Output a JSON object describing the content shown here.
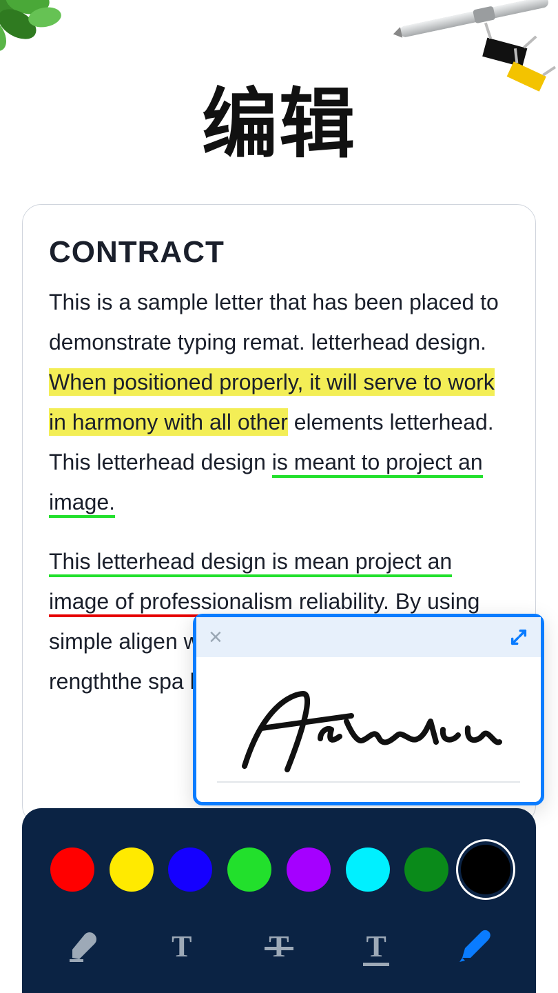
{
  "page_title": "编辑",
  "document": {
    "heading": "CONTRACT",
    "p1_a": "This is a sample letter that has been placed to demonstrate typing remat. letterhead design. ",
    "p1_hl": "When positioned properly, it will serve to work in harmony with all other",
    "p1_b": " elements letterhead. This letterhead design ",
    "p1_ulg": "is meant to project an image.",
    "p2_ulg": "This letterhead design is mean project an",
    "p2_ulr": "image of professionalism reliability. By using",
    "p2_rest": " simple aligen with open spacious feeling rengththe spa haesthetics th"
  },
  "signature": {
    "text": "Franken"
  },
  "colors": [
    {
      "name": "red",
      "hex": "#ff0000"
    },
    {
      "name": "yellow",
      "hex": "#ffea00"
    },
    {
      "name": "blue",
      "hex": "#1500ff"
    },
    {
      "name": "green",
      "hex": "#22e02c"
    },
    {
      "name": "purple",
      "hex": "#a500ff"
    },
    {
      "name": "cyan",
      "hex": "#00f0ff"
    },
    {
      "name": "dark-green",
      "hex": "#0a8a1a"
    },
    {
      "name": "black",
      "hex": "#000000"
    }
  ],
  "selected_color_index": 7,
  "tools": [
    {
      "name": "highlighter",
      "active": false
    },
    {
      "name": "text",
      "active": false
    },
    {
      "name": "strikethrough",
      "active": false
    },
    {
      "name": "underline",
      "active": false
    },
    {
      "name": "signature",
      "active": true
    }
  ]
}
